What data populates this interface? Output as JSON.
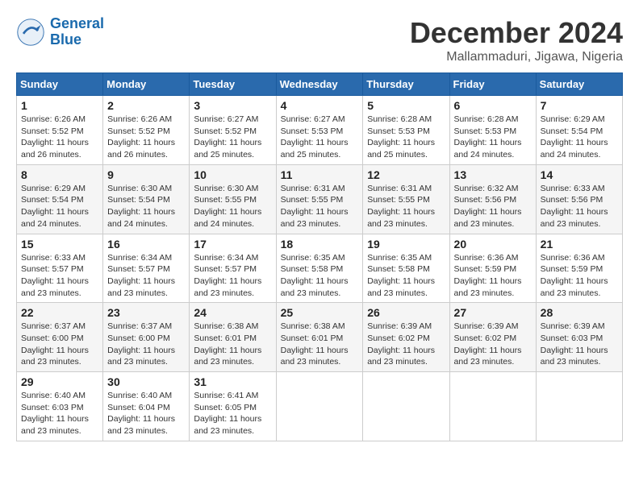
{
  "header": {
    "logo_line1": "General",
    "logo_line2": "Blue",
    "month": "December 2024",
    "location": "Mallammaduri, Jigawa, Nigeria"
  },
  "days_of_week": [
    "Sunday",
    "Monday",
    "Tuesday",
    "Wednesday",
    "Thursday",
    "Friday",
    "Saturday"
  ],
  "weeks": [
    [
      {
        "day": "1",
        "info": "Sunrise: 6:26 AM\nSunset: 5:52 PM\nDaylight: 11 hours and 26 minutes."
      },
      {
        "day": "2",
        "info": "Sunrise: 6:26 AM\nSunset: 5:52 PM\nDaylight: 11 hours and 26 minutes."
      },
      {
        "day": "3",
        "info": "Sunrise: 6:27 AM\nSunset: 5:52 PM\nDaylight: 11 hours and 25 minutes."
      },
      {
        "day": "4",
        "info": "Sunrise: 6:27 AM\nSunset: 5:53 PM\nDaylight: 11 hours and 25 minutes."
      },
      {
        "day": "5",
        "info": "Sunrise: 6:28 AM\nSunset: 5:53 PM\nDaylight: 11 hours and 25 minutes."
      },
      {
        "day": "6",
        "info": "Sunrise: 6:28 AM\nSunset: 5:53 PM\nDaylight: 11 hours and 24 minutes."
      },
      {
        "day": "7",
        "info": "Sunrise: 6:29 AM\nSunset: 5:54 PM\nDaylight: 11 hours and 24 minutes."
      }
    ],
    [
      {
        "day": "8",
        "info": "Sunrise: 6:29 AM\nSunset: 5:54 PM\nDaylight: 11 hours and 24 minutes."
      },
      {
        "day": "9",
        "info": "Sunrise: 6:30 AM\nSunset: 5:54 PM\nDaylight: 11 hours and 24 minutes."
      },
      {
        "day": "10",
        "info": "Sunrise: 6:30 AM\nSunset: 5:55 PM\nDaylight: 11 hours and 24 minutes."
      },
      {
        "day": "11",
        "info": "Sunrise: 6:31 AM\nSunset: 5:55 PM\nDaylight: 11 hours and 23 minutes."
      },
      {
        "day": "12",
        "info": "Sunrise: 6:31 AM\nSunset: 5:55 PM\nDaylight: 11 hours and 23 minutes."
      },
      {
        "day": "13",
        "info": "Sunrise: 6:32 AM\nSunset: 5:56 PM\nDaylight: 11 hours and 23 minutes."
      },
      {
        "day": "14",
        "info": "Sunrise: 6:33 AM\nSunset: 5:56 PM\nDaylight: 11 hours and 23 minutes."
      }
    ],
    [
      {
        "day": "15",
        "info": "Sunrise: 6:33 AM\nSunset: 5:57 PM\nDaylight: 11 hours and 23 minutes."
      },
      {
        "day": "16",
        "info": "Sunrise: 6:34 AM\nSunset: 5:57 PM\nDaylight: 11 hours and 23 minutes."
      },
      {
        "day": "17",
        "info": "Sunrise: 6:34 AM\nSunset: 5:57 PM\nDaylight: 11 hours and 23 minutes."
      },
      {
        "day": "18",
        "info": "Sunrise: 6:35 AM\nSunset: 5:58 PM\nDaylight: 11 hours and 23 minutes."
      },
      {
        "day": "19",
        "info": "Sunrise: 6:35 AM\nSunset: 5:58 PM\nDaylight: 11 hours and 23 minutes."
      },
      {
        "day": "20",
        "info": "Sunrise: 6:36 AM\nSunset: 5:59 PM\nDaylight: 11 hours and 23 minutes."
      },
      {
        "day": "21",
        "info": "Sunrise: 6:36 AM\nSunset: 5:59 PM\nDaylight: 11 hours and 23 minutes."
      }
    ],
    [
      {
        "day": "22",
        "info": "Sunrise: 6:37 AM\nSunset: 6:00 PM\nDaylight: 11 hours and 23 minutes."
      },
      {
        "day": "23",
        "info": "Sunrise: 6:37 AM\nSunset: 6:00 PM\nDaylight: 11 hours and 23 minutes."
      },
      {
        "day": "24",
        "info": "Sunrise: 6:38 AM\nSunset: 6:01 PM\nDaylight: 11 hours and 23 minutes."
      },
      {
        "day": "25",
        "info": "Sunrise: 6:38 AM\nSunset: 6:01 PM\nDaylight: 11 hours and 23 minutes."
      },
      {
        "day": "26",
        "info": "Sunrise: 6:39 AM\nSunset: 6:02 PM\nDaylight: 11 hours and 23 minutes."
      },
      {
        "day": "27",
        "info": "Sunrise: 6:39 AM\nSunset: 6:02 PM\nDaylight: 11 hours and 23 minutes."
      },
      {
        "day": "28",
        "info": "Sunrise: 6:39 AM\nSunset: 6:03 PM\nDaylight: 11 hours and 23 minutes."
      }
    ],
    [
      {
        "day": "29",
        "info": "Sunrise: 6:40 AM\nSunset: 6:03 PM\nDaylight: 11 hours and 23 minutes."
      },
      {
        "day": "30",
        "info": "Sunrise: 6:40 AM\nSunset: 6:04 PM\nDaylight: 11 hours and 23 minutes."
      },
      {
        "day": "31",
        "info": "Sunrise: 6:41 AM\nSunset: 6:05 PM\nDaylight: 11 hours and 23 minutes."
      },
      null,
      null,
      null,
      null
    ]
  ]
}
